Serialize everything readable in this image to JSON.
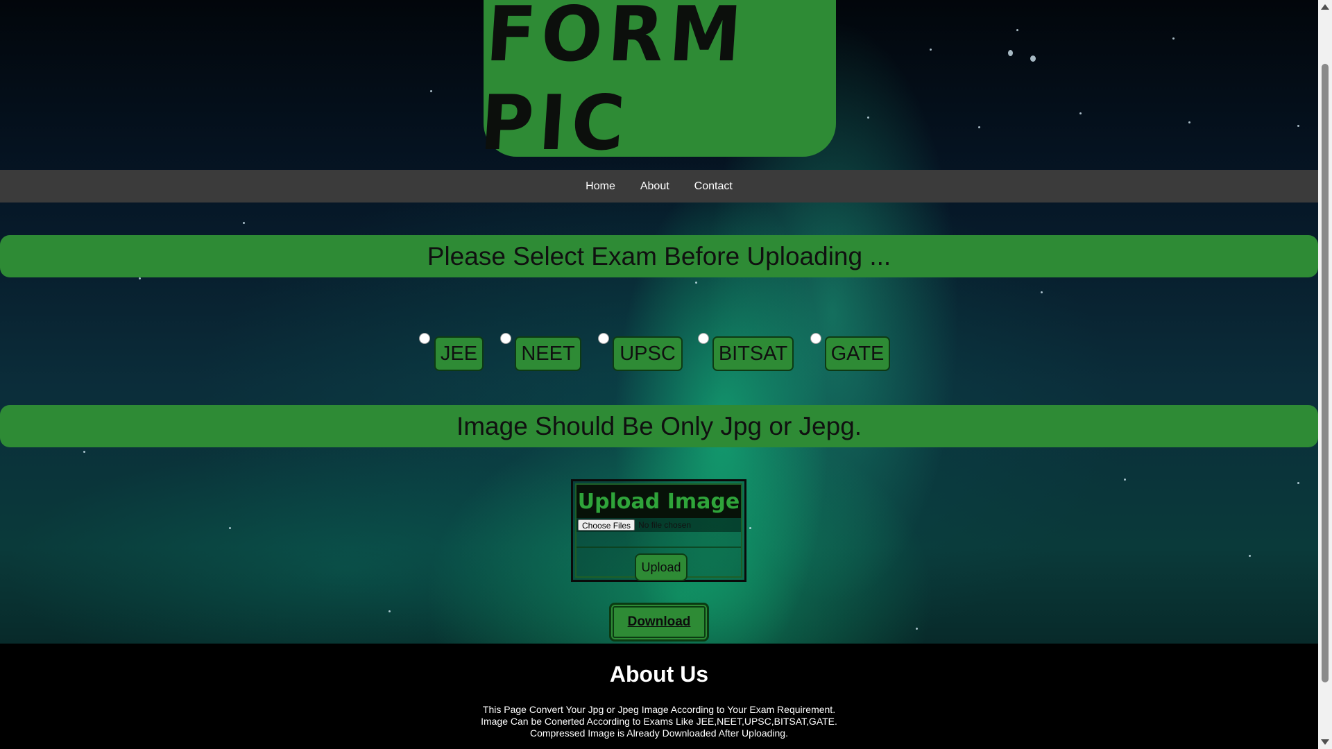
{
  "logo": {
    "text": "FORM PIC"
  },
  "nav": {
    "items": [
      "Home",
      "About",
      "Contact"
    ]
  },
  "banners": {
    "select_exam": "Please Select Exam Before Uploading ...",
    "format_note": "Image Should Be Only Jpg or Jepg."
  },
  "exams": [
    "JEE",
    "NEET",
    "UPSC",
    "BITSAT",
    "GATE"
  ],
  "upload": {
    "title": "Upload Image",
    "choose_files_label": "Choose Files",
    "file_status": "No file chosen",
    "upload_button": "Upload"
  },
  "download": {
    "label": "Download"
  },
  "about": {
    "title": "About Us",
    "lines": [
      "This Page Convert Your Jpg or Jpeg Image According to Your Exam Requirement.",
      "Image Can be Conerted According to Exams Like JEE,NEET,UPSC,BITSAT,GATE.",
      "Compressed Image is Already Downloaded After Uploading."
    ]
  },
  "colors": {
    "accent_green": "#2e8b35",
    "nav_bg": "#3b3b3b",
    "footer_bg": "#000000"
  }
}
